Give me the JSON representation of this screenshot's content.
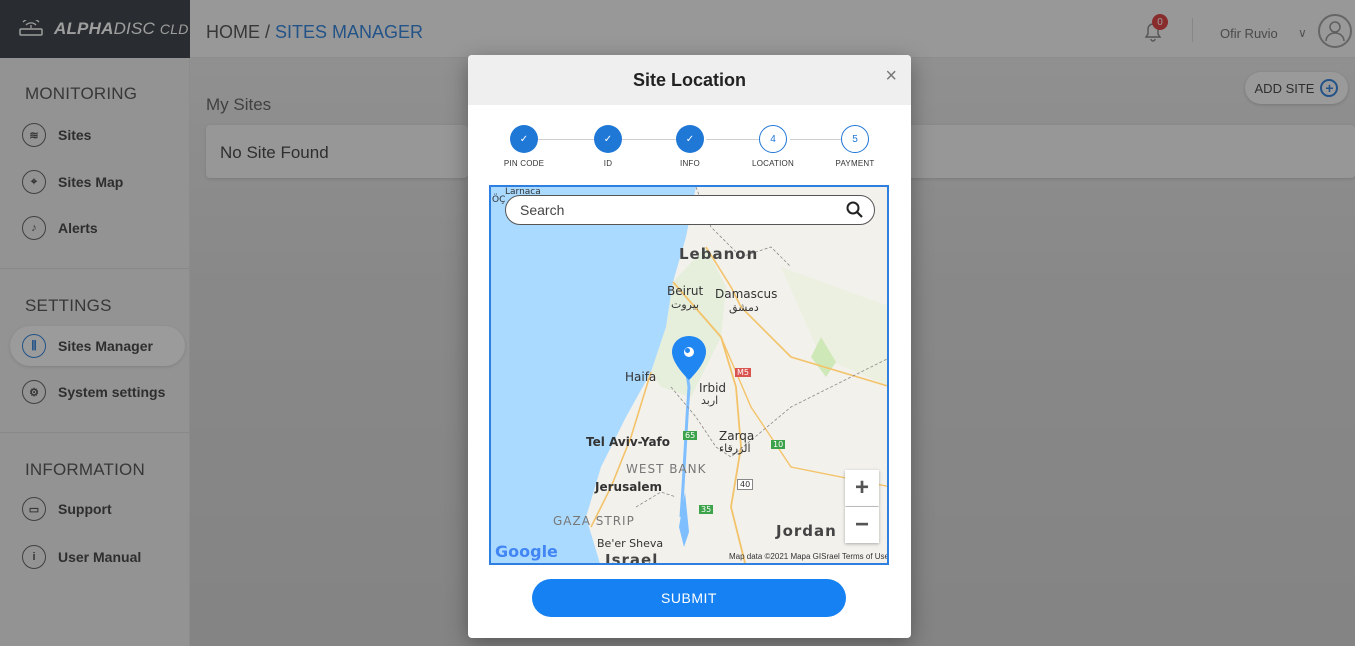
{
  "brand": {
    "name_bold": "ALPHA",
    "name_italic": "DISC",
    "suffix": "CLD"
  },
  "breadcrumb": {
    "home": "HOME / ",
    "current": "SITES MANAGER"
  },
  "header": {
    "notifications_count": "0",
    "user_name": "Ofir Ruvio",
    "user_chevron": "∨"
  },
  "sidebar": {
    "monitoring_title": "MONITORING",
    "settings_title": "SETTINGS",
    "information_title": "INFORMATION",
    "items": [
      {
        "label": "Sites",
        "icon": "layers-icon"
      },
      {
        "label": "Sites Map",
        "icon": "map-pin-icon"
      },
      {
        "label": "Alerts",
        "icon": "bell-icon"
      },
      {
        "label": "Sites Manager",
        "icon": "sliders-icon"
      },
      {
        "label": "System settings",
        "icon": "gear-icon"
      },
      {
        "label": "Support",
        "icon": "chat-icon"
      },
      {
        "label": "User Manual",
        "icon": "info-icon"
      }
    ]
  },
  "main": {
    "title": "My Sites",
    "empty_message": "No Site Found",
    "add_site_label": "ADD SITE"
  },
  "modal": {
    "title": "Site Location",
    "close": "×",
    "steps": [
      {
        "label": "PIN CODE",
        "state": "done",
        "mark": "✓"
      },
      {
        "label": "ID",
        "state": "done",
        "mark": "✓"
      },
      {
        "label": "INFO",
        "state": "done",
        "mark": "✓"
      },
      {
        "label": "LOCATION",
        "state": "todo",
        "mark": "4"
      },
      {
        "label": "PAYMENT",
        "state": "todo",
        "mark": "5"
      }
    ],
    "map": {
      "search_placeholder": "Search",
      "labels": {
        "larnaca": "Larnaca",
        "lebanon": "Lebanon",
        "beirut": "Beirut",
        "beirut_ar": "بيروت",
        "damascus": "Damascus",
        "damascus_ar": "دمشق",
        "haifa": "Haifa",
        "irbid": "Irbid",
        "irbid_ar": "اربد",
        "tel_aviv": "Tel Aviv-Yafo",
        "zarqa": "Zarqa",
        "zarqa_ar": "الزرقاء",
        "west_bank": "WEST BANK",
        "jerusalem": "Jerusalem",
        "gaza": "GAZA STRIP",
        "jordan": "Jordan",
        "beer_sheva": "Be'er Sheva",
        "israel": "Israel",
        "oc": "ÖÇ",
        "m5": "M5",
        "r65": "65",
        "r10": "10",
        "r40": "40",
        "r35": "35"
      },
      "zoom_in": "+",
      "zoom_out": "−",
      "google": "Google",
      "attribution": "Map data ©2021 Mapa GISrael   Terms of Use"
    },
    "submit_label": "SUBMIT"
  },
  "colors": {
    "accent": "#1f77d6",
    "submit": "#1681f2",
    "badge": "#d93030"
  }
}
